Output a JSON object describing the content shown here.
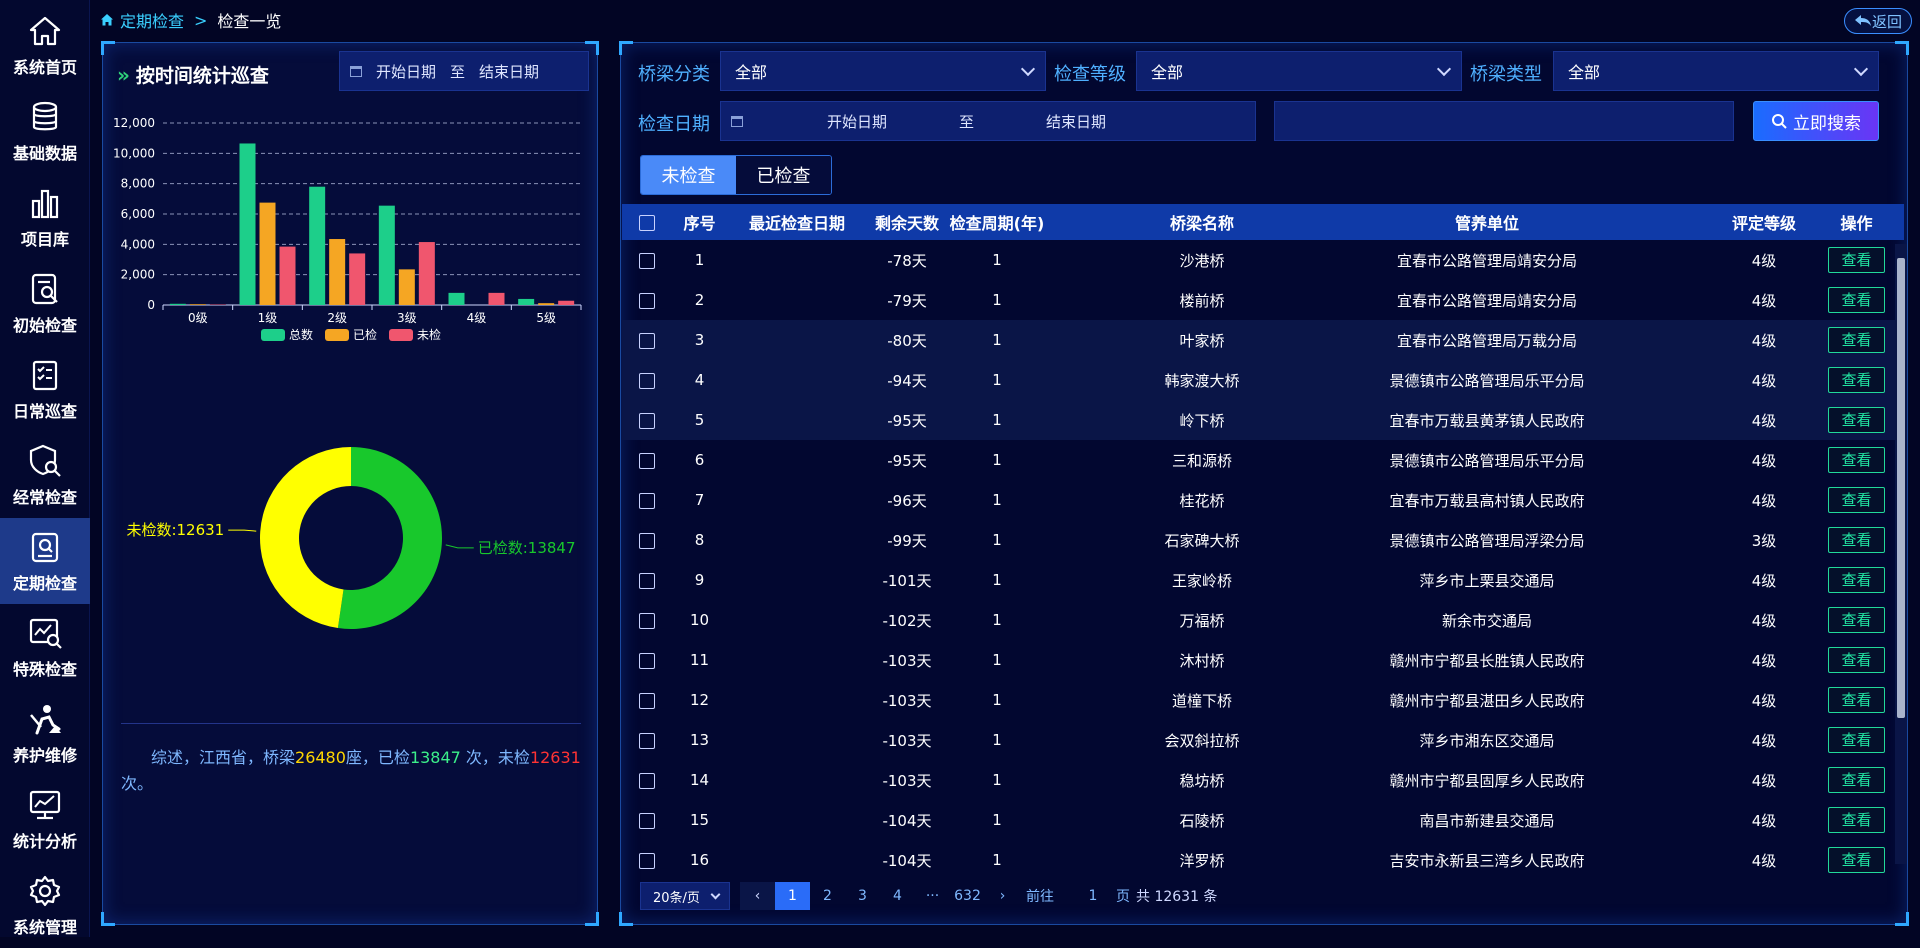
{
  "sidebar": {
    "items": [
      {
        "label": "系统首页",
        "icon": "home-icon"
      },
      {
        "label": "基础数据",
        "icon": "database-icon"
      },
      {
        "label": "项目库",
        "icon": "bar-chart-icon"
      },
      {
        "label": "初始检查",
        "icon": "search-document-icon"
      },
      {
        "label": "日常巡查",
        "icon": "checklist-icon"
      },
      {
        "label": "经常检查",
        "icon": "shield-search-icon"
      },
      {
        "label": "定期检查",
        "icon": "clipboard-search-icon"
      },
      {
        "label": "特殊检查",
        "icon": "chart-search-icon"
      },
      {
        "label": "养护维修",
        "icon": "worker-icon"
      },
      {
        "label": "统计分析",
        "icon": "monitor-chart-icon"
      },
      {
        "label": "系统管理",
        "icon": "gear-icon"
      }
    ],
    "active_index": 6
  },
  "breadcrumb": {
    "parent": "定期检查",
    "separator": ">",
    "current": "检查一览"
  },
  "back_label": "返回",
  "left_panel": {
    "title": "按时间统计巡查",
    "start_placeholder": "开始日期",
    "to_label": "至",
    "end_placeholder": "结束日期"
  },
  "chart_data": [
    {
      "type": "bar",
      "categories": [
        "0级",
        "1级",
        "2级",
        "3级",
        "4级",
        "5级"
      ],
      "series": [
        {
          "name": "总数",
          "color": "#1dcf8a",
          "values": [
            80,
            10650,
            7800,
            6550,
            800,
            400
          ]
        },
        {
          "name": "已检",
          "color": "#f5a623",
          "values": [
            50,
            6750,
            4350,
            2350,
            0,
            120
          ]
        },
        {
          "name": "未检",
          "color": "#f0566e",
          "values": [
            30,
            3850,
            3400,
            4150,
            800,
            280
          ]
        }
      ],
      "y_ticks": [
        "0",
        "2,000",
        "4,000",
        "6,000",
        "8,000",
        "10,000",
        "12,000"
      ],
      "ylim": [
        0,
        12000
      ],
      "grid": true,
      "legend": "bottom"
    },
    {
      "type": "pie",
      "slices": [
        {
          "label": "已检数:13847",
          "value": 13847,
          "color": "#18c82c"
        },
        {
          "label": "未检数:12631",
          "value": 12631,
          "color": "#ffff00"
        }
      ]
    }
  ],
  "summary": {
    "prefix": "综述，江西省，桥梁",
    "bridges": "26480",
    "mid1": "座，已检",
    "checked": "13847",
    "mid2": " 次，未检",
    "unchecked": "12631",
    "suffix": "次。"
  },
  "filters": {
    "category_label": "桥梁分类",
    "category_value": "全部",
    "level_label": "检查等级",
    "level_value": "全部",
    "type_label": "桥梁类型",
    "type_value": "全部",
    "date_label": "检查日期",
    "start_placeholder": "开始日期",
    "to_label": "至",
    "end_placeholder": "结束日期",
    "search_label": "立即搜索"
  },
  "tabs": [
    "未检查",
    "已检查"
  ],
  "table": {
    "columns": [
      "序号",
      "最近检查日期",
      "剩余天数",
      "检查周期(年)",
      "桥梁名称",
      "管养单位",
      "评定等级",
      "操作"
    ],
    "action_label": "查看",
    "rows": [
      [
        "1",
        "",
        "-78天",
        "1",
        "沙港桥",
        "宜春市公路管理局靖安分局",
        "4级"
      ],
      [
        "2",
        "",
        "-79天",
        "1",
        "楼前桥",
        "宜春市公路管理局靖安分局",
        "4级"
      ],
      [
        "3",
        "",
        "-80天",
        "1",
        "叶家桥",
        "宜春市公路管理局万载分局",
        "4级"
      ],
      [
        "4",
        "",
        "-94天",
        "1",
        "韩家渡大桥",
        "景德镇市公路管理局乐平分局",
        "4级"
      ],
      [
        "5",
        "",
        "-95天",
        "1",
        "岭下桥",
        "宜春市万载县黄茅镇人民政府",
        "4级"
      ],
      [
        "6",
        "",
        "-95天",
        "1",
        "三和源桥",
        "景德镇市公路管理局乐平分局",
        "4级"
      ],
      [
        "7",
        "",
        "-96天",
        "1",
        "桂花桥",
        "宜春市万载县高村镇人民政府",
        "4级"
      ],
      [
        "8",
        "",
        "-99天",
        "1",
        "石家碑大桥",
        "景德镇市公路管理局浮梁分局",
        "3级"
      ],
      [
        "9",
        "",
        "-101天",
        "1",
        "王家岭桥",
        "萍乡市上栗县交通局",
        "4级"
      ],
      [
        "10",
        "",
        "-102天",
        "1",
        "万福桥",
        "新余市交通局",
        "4级"
      ],
      [
        "11",
        "",
        "-103天",
        "1",
        "沐村桥",
        "赣州市宁都县长胜镇人民政府",
        "4级"
      ],
      [
        "12",
        "",
        "-103天",
        "1",
        "道橦下桥",
        "赣州市宁都县湛田乡人民政府",
        "4级"
      ],
      [
        "13",
        "",
        "-103天",
        "1",
        "会双斜拉桥",
        "萍乡市湘东区交通局",
        "4级"
      ],
      [
        "14",
        "",
        "-103天",
        "1",
        "稳坊桥",
        "赣州市宁都县固厚乡人民政府",
        "4级"
      ],
      [
        "15",
        "",
        "-104天",
        "1",
        "石陵桥",
        "南昌市新建县交通局",
        "4级"
      ],
      [
        "16",
        "",
        "-104天",
        "1",
        "洋罗桥",
        "吉安市永新县三湾乡人民政府",
        "4级"
      ]
    ]
  },
  "pagination": {
    "page_size": "20条/页",
    "pages": [
      "1",
      "2",
      "3",
      "4",
      "···",
      "632"
    ],
    "current": "1",
    "goto_prefix": "前往",
    "goto_value": "1",
    "goto_suffix": "页",
    "total": "共 12631 条"
  }
}
